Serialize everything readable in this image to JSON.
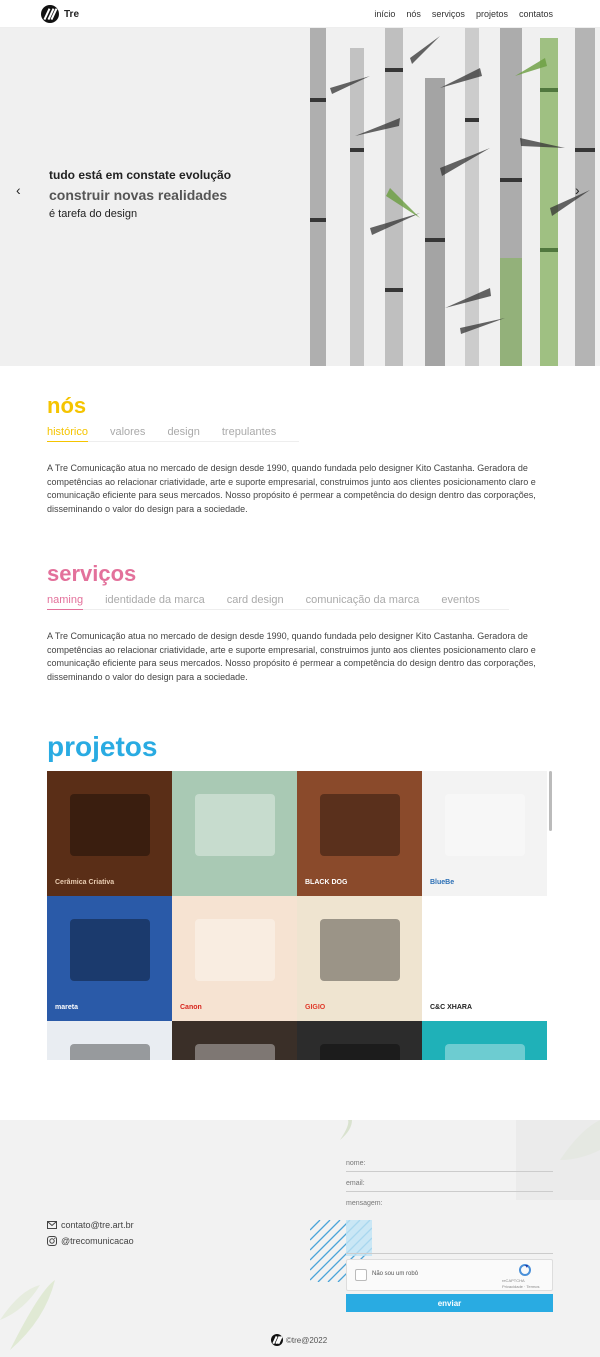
{
  "brand": {
    "name": "Tre"
  },
  "nav": {
    "items": [
      "início",
      "nós",
      "serviços",
      "projetos",
      "contatos"
    ]
  },
  "hero": {
    "line1": "tudo está em constate evolução",
    "line2": "construir novas realidades",
    "line3": "é tarefa do design",
    "prev_icon": "‹",
    "next_icon": "›"
  },
  "nos": {
    "title": "nós",
    "color": "#f5c400",
    "tabs": [
      "histórico",
      "valores",
      "design",
      "trepulantes"
    ],
    "text": " A Tre Comunicação atua no mercado de design desde 1990, quando fundada pelo designer Kito Castanha. Geradora de competências ao relacionar criatividade, arte e suporte empresarial, construimos junto aos clientes posicionamento claro e comunicação eficiente para seus mercados. Nosso propósito é permear a competência do design dentro das corporações, disseminando o valor do design para a sociedade."
  },
  "servicos": {
    "title": "serviços",
    "color": "#e3719b",
    "tabs": [
      "naming",
      "identidade da marca",
      "card design",
      "comunicação da marca",
      "eventos"
    ],
    "text": " A Tre Comunicação atua no mercado de design desde 1990, quando fundada pelo designer Kito Castanha. Geradora de competências ao relacionar criatividade, arte e suporte empresarial, construimos junto aos clientes posicionamento claro e comunicação eficiente para seus mercados. Nosso propósito é permear a competência do design dentro das corporações, disseminando o valor do design para a sociedade."
  },
  "projetos": {
    "title": "projetos",
    "color": "#29abe2",
    "tiles": [
      {
        "name": "ceramica-criativa",
        "bg": "#5a2e17",
        "label": "Cerâmica Criativa",
        "label_color": "#e8cbb0"
      },
      {
        "name": "livros-infantis",
        "bg": "#a9c9b4",
        "label": "",
        "label_color": "#333"
      },
      {
        "name": "black-dog",
        "bg": "#8a4a2b",
        "label": "BLACK DOG",
        "label_color": "#fff"
      },
      {
        "name": "bluebe",
        "bg": "#f3f3f3",
        "label": "BlueBe",
        "label_color": "#2b6fb5"
      },
      {
        "name": "mareta-cafe",
        "bg": "#2a5aa8",
        "label": "mareta",
        "label_color": "#ffffff"
      },
      {
        "name": "canon",
        "bg": "#f6e3d2",
        "label": "Canon",
        "label_color": "#d7261e"
      },
      {
        "name": "gigio",
        "bg": "#efe4d0",
        "label": "GIGIO",
        "label_color": "#e03a2a"
      },
      {
        "name": "xhara",
        "bg": "#ffffff",
        "label": "C&C XHARA",
        "label_color": "#222"
      },
      {
        "name": "app-mockup",
        "bg": "#e9edf2",
        "label": "",
        "label_color": "#333"
      },
      {
        "name": "fazenda",
        "bg": "#3a2f28",
        "label": "",
        "label_color": "#fff"
      },
      {
        "name": "dark-phone",
        "bg": "#2c2c2c",
        "label": "",
        "label_color": "#fff"
      },
      {
        "name": "teal-papers",
        "bg": "#1fb1b8",
        "label": "",
        "label_color": "#fff"
      }
    ]
  },
  "footer": {
    "email": "contato@tre.art.br",
    "instagram": "@trecomunicacao",
    "form": {
      "name_placeholder": "nome:",
      "email_placeholder": "email:",
      "message_placeholder": "mensagem:",
      "captcha_label": "Não sou um robô",
      "captcha_brand": "reCAPTCHA",
      "captcha_links": "Privacidade · Termos",
      "send_label": "enviar"
    },
    "copyright": "©tre@2022"
  }
}
